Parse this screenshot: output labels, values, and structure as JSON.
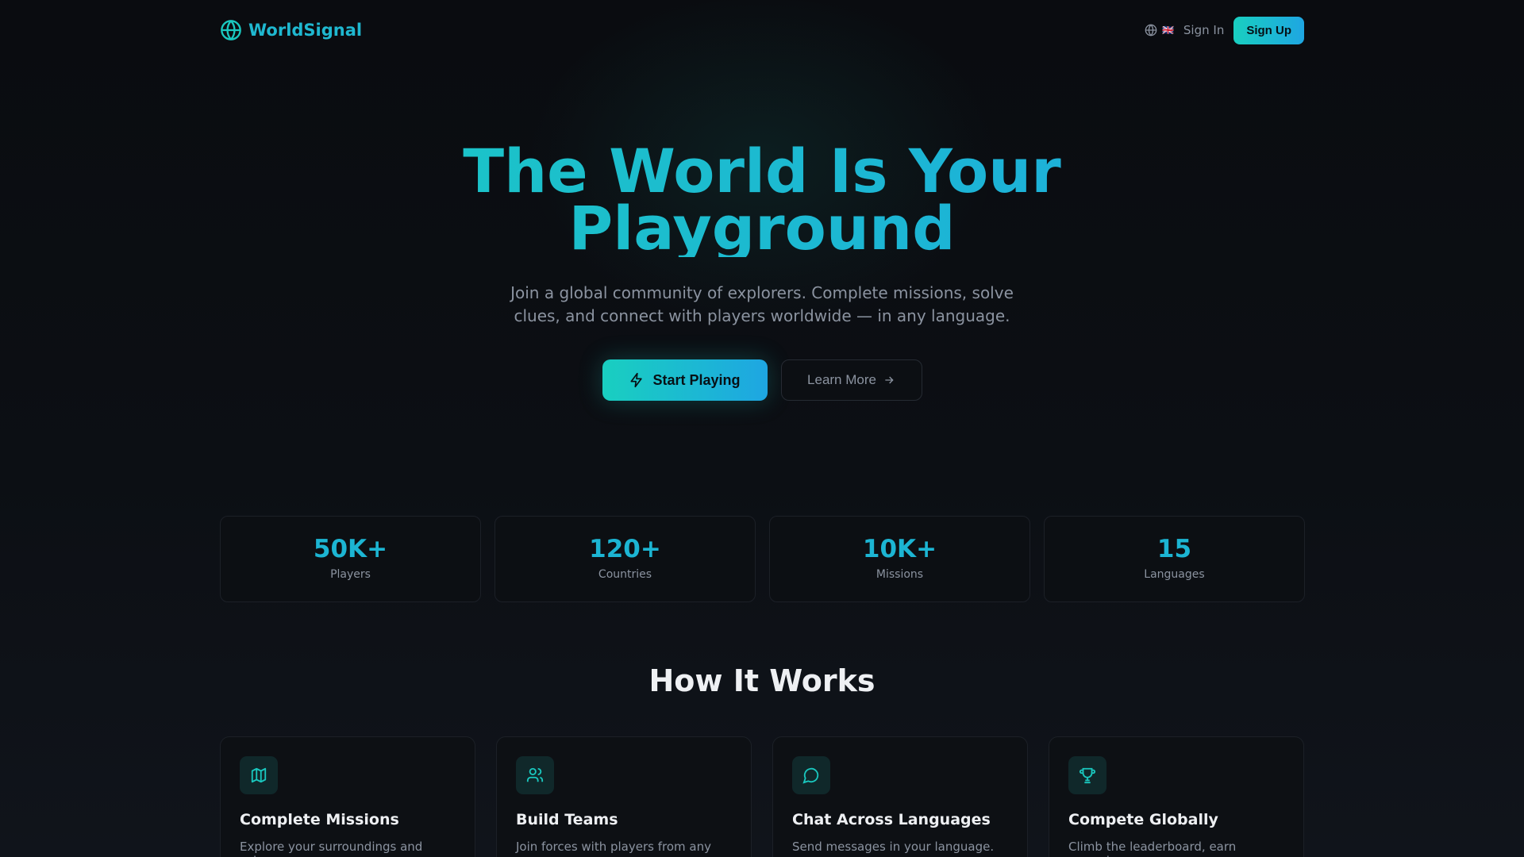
{
  "brand": {
    "name": "WorldSignal"
  },
  "nav": {
    "language_flag": "🇬🇧",
    "sign_in": "Sign In",
    "sign_up": "Sign Up"
  },
  "hero": {
    "title_line1": "The World Is Your",
    "title_line2": "Playground",
    "subtitle": "Join a global community of explorers. Complete missions, solve clues, and connect with players worldwide — in any language.",
    "start_label": "Start Playing",
    "learn_label": "Learn More"
  },
  "stats": [
    {
      "value": "50K+",
      "label": "Players"
    },
    {
      "value": "120+",
      "label": "Countries"
    },
    {
      "value": "10K+",
      "label": "Missions"
    },
    {
      "value": "15",
      "label": "Languages"
    }
  ],
  "how": {
    "title": "How It Works",
    "features": [
      {
        "icon": "map-icon",
        "title": "Complete Missions",
        "desc": "Explore your surroundings and solve"
      },
      {
        "icon": "users-icon",
        "title": "Build Teams",
        "desc": "Join forces with players from any"
      },
      {
        "icon": "chat-icon",
        "title": "Chat Across Languages",
        "desc": "Send messages in your language."
      },
      {
        "icon": "trophy-icon",
        "title": "Compete Globally",
        "desc": "Climb the leaderboard, earn rewards,"
      }
    ]
  }
}
